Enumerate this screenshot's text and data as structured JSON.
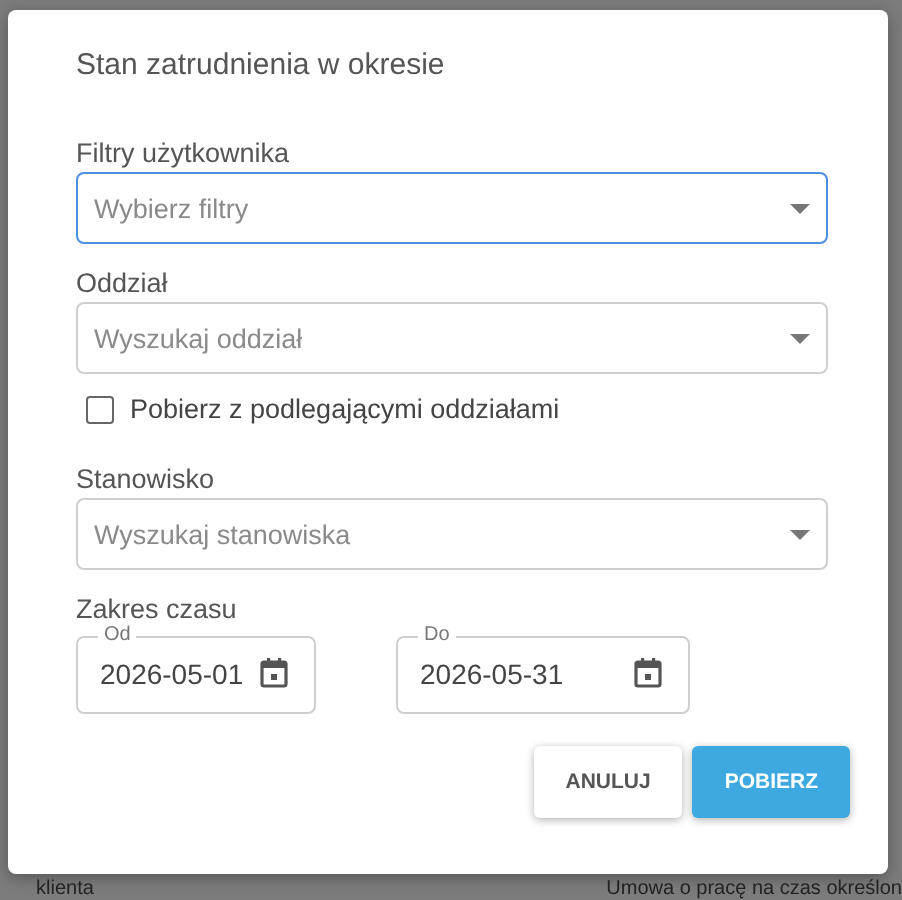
{
  "dialog": {
    "title": "Stan zatrudnienia w okresie",
    "controls": [
      {
        "kind": "select",
        "label": "Filtry użytkownika",
        "placeholder": "Wybierz filtry",
        "focused": true
      },
      {
        "kind": "select",
        "label": "Oddział",
        "placeholder": "Wyszukaj oddział",
        "focused": false
      },
      {
        "kind": "checkbox",
        "label": "Pobierz z podlegającymi oddziałami",
        "checked": false
      },
      {
        "kind": "select",
        "label": "Stanowisko",
        "placeholder": "Wyszukaj stanowiska",
        "focused": false
      },
      {
        "kind": "daterange",
        "label": "Zakres czasu",
        "from": {
          "label": "Od",
          "value": "2026-05-01"
        },
        "to": {
          "label": "Do",
          "value": "2026-05-31"
        }
      }
    ],
    "buttons": [
      {
        "label": "ANULUJ",
        "kind": "secondary"
      },
      {
        "label": "POBIERZ",
        "kind": "primary"
      }
    ]
  },
  "background_texts": [
    "klienta",
    "Umowa o pracę na czas określon"
  ]
}
